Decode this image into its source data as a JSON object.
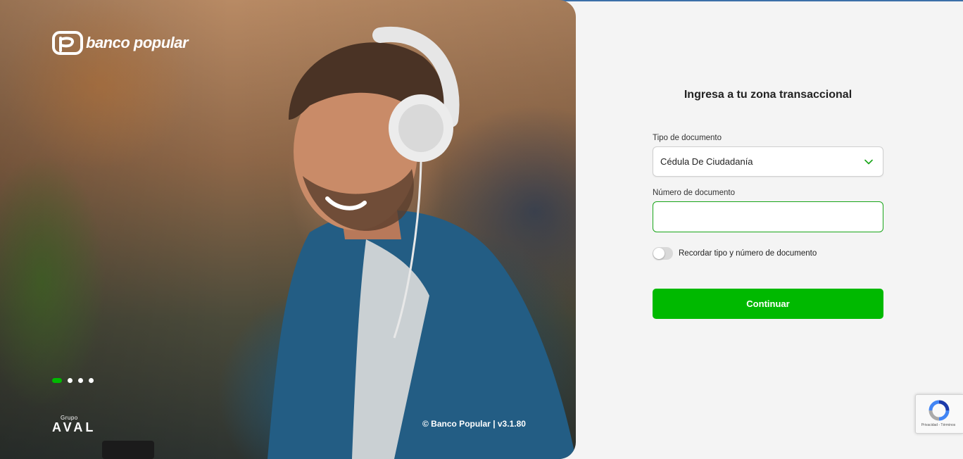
{
  "brand": {
    "name": "banco popular",
    "logo_icon": "banco-popular-logo-icon"
  },
  "hero": {
    "carousel": {
      "total": 4,
      "active": 1
    },
    "group_label": "Grupo",
    "group_name": "AVAL",
    "copyright": "© Banco Popular | v3.1.80"
  },
  "form": {
    "title": "Ingresa a tu zona transaccional",
    "doc_type_label": "Tipo de documento",
    "doc_type_value": "Cédula De Ciudadanía",
    "doc_number_label": "Número de documento",
    "doc_number_value": "",
    "doc_number_placeholder": "",
    "remember_label": "Recordar tipo y número de documento",
    "remember_on": false,
    "submit_label": "Continuar"
  },
  "recaptcha": {
    "links": "Privacidad - Términos"
  },
  "colors": {
    "accent": "#00b900",
    "focus_border": "#19a519",
    "background": "#f4f4f4"
  }
}
